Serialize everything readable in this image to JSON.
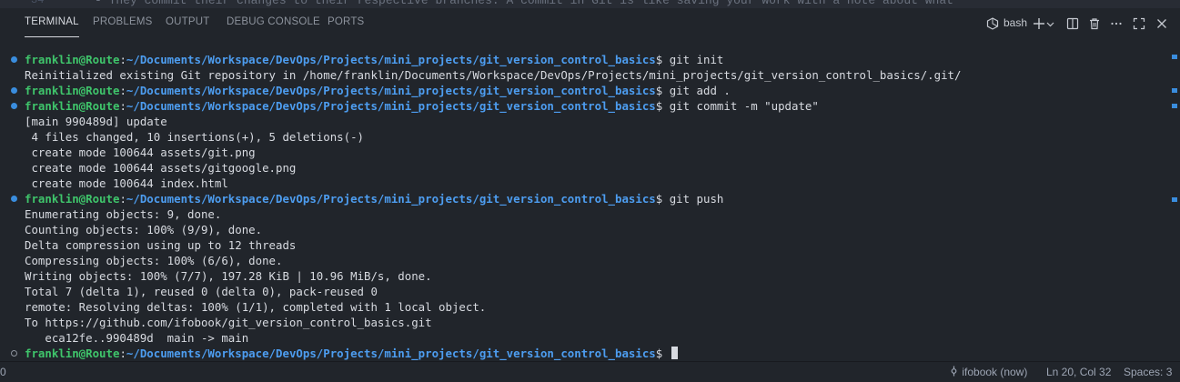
{
  "editor": {
    "line_number": "34",
    "line_text": "- They commit their changes to their respective branches. A commit in Git is like saving your work with a note about what"
  },
  "panel": {
    "tabs": [
      "TERMINAL",
      "PROBLEMS",
      "OUTPUT",
      "DEBUG CONSOLE",
      "PORTS"
    ],
    "active_tab": "TERMINAL",
    "shell": "bash",
    "actions": [
      "new-terminal",
      "split-terminal",
      "kill-terminal",
      "more-actions",
      "maximize-panel",
      "close-panel"
    ]
  },
  "terminal": {
    "prompt_user": "franklin@Route",
    "prompt_sep": ":",
    "prompt_path": "~/Documents/Workspace/DevOps/Projects/mini_projects/git_version_control_basics",
    "prompt_end": "$",
    "lines": [
      {
        "kind": "prompt",
        "cmd": " git init"
      },
      {
        "kind": "out",
        "text": "Reinitialized existing Git repository in /home/franklin/Documents/Workspace/DevOps/Projects/mini_projects/git_version_control_basics/.git/"
      },
      {
        "kind": "prompt",
        "cmd": " git add ."
      },
      {
        "kind": "prompt",
        "cmd": " git commit -m \"update\""
      },
      {
        "kind": "out",
        "text": "[main 990489d] update"
      },
      {
        "kind": "out",
        "text": " 4 files changed, 10 insertions(+), 5 deletions(-)"
      },
      {
        "kind": "out",
        "text": " create mode 100644 assets/git.png"
      },
      {
        "kind": "out",
        "text": " create mode 100644 assets/gitgoogle.png"
      },
      {
        "kind": "out",
        "text": " create mode 100644 index.html"
      },
      {
        "kind": "prompt",
        "cmd": " git push"
      },
      {
        "kind": "out",
        "text": "Enumerating objects: 9, done."
      },
      {
        "kind": "out",
        "text": "Counting objects: 100% (9/9), done."
      },
      {
        "kind": "out",
        "text": "Delta compression using up to 12 threads"
      },
      {
        "kind": "out",
        "text": "Compressing objects: 100% (6/6), done."
      },
      {
        "kind": "out",
        "text": "Writing objects: 100% (7/7), 197.28 KiB | 10.96 MiB/s, done."
      },
      {
        "kind": "out",
        "text": "Total 7 (delta 1), reused 0 (delta 0), pack-reused 0"
      },
      {
        "kind": "out",
        "text": "remote: Resolving deltas: 100% (1/1), completed with 1 local object."
      },
      {
        "kind": "out",
        "text": "To https://github.com/ifobook/git_version_control_basics.git"
      },
      {
        "kind": "out",
        "text": "   eca12fe..990489d  main -> main"
      },
      {
        "kind": "prompt_active",
        "cmd": " "
      }
    ]
  },
  "statusbar": {
    "left": "0",
    "git_blame": "ifobook (now)",
    "cursor_position": "Ln 20, Col 32",
    "indentation": "Spaces: 3"
  },
  "colors": {
    "background": "#21252b",
    "prompt_user": "#3fc56b",
    "prompt_path": "#4d9df0",
    "decoration_dot": "#3a8dde"
  }
}
